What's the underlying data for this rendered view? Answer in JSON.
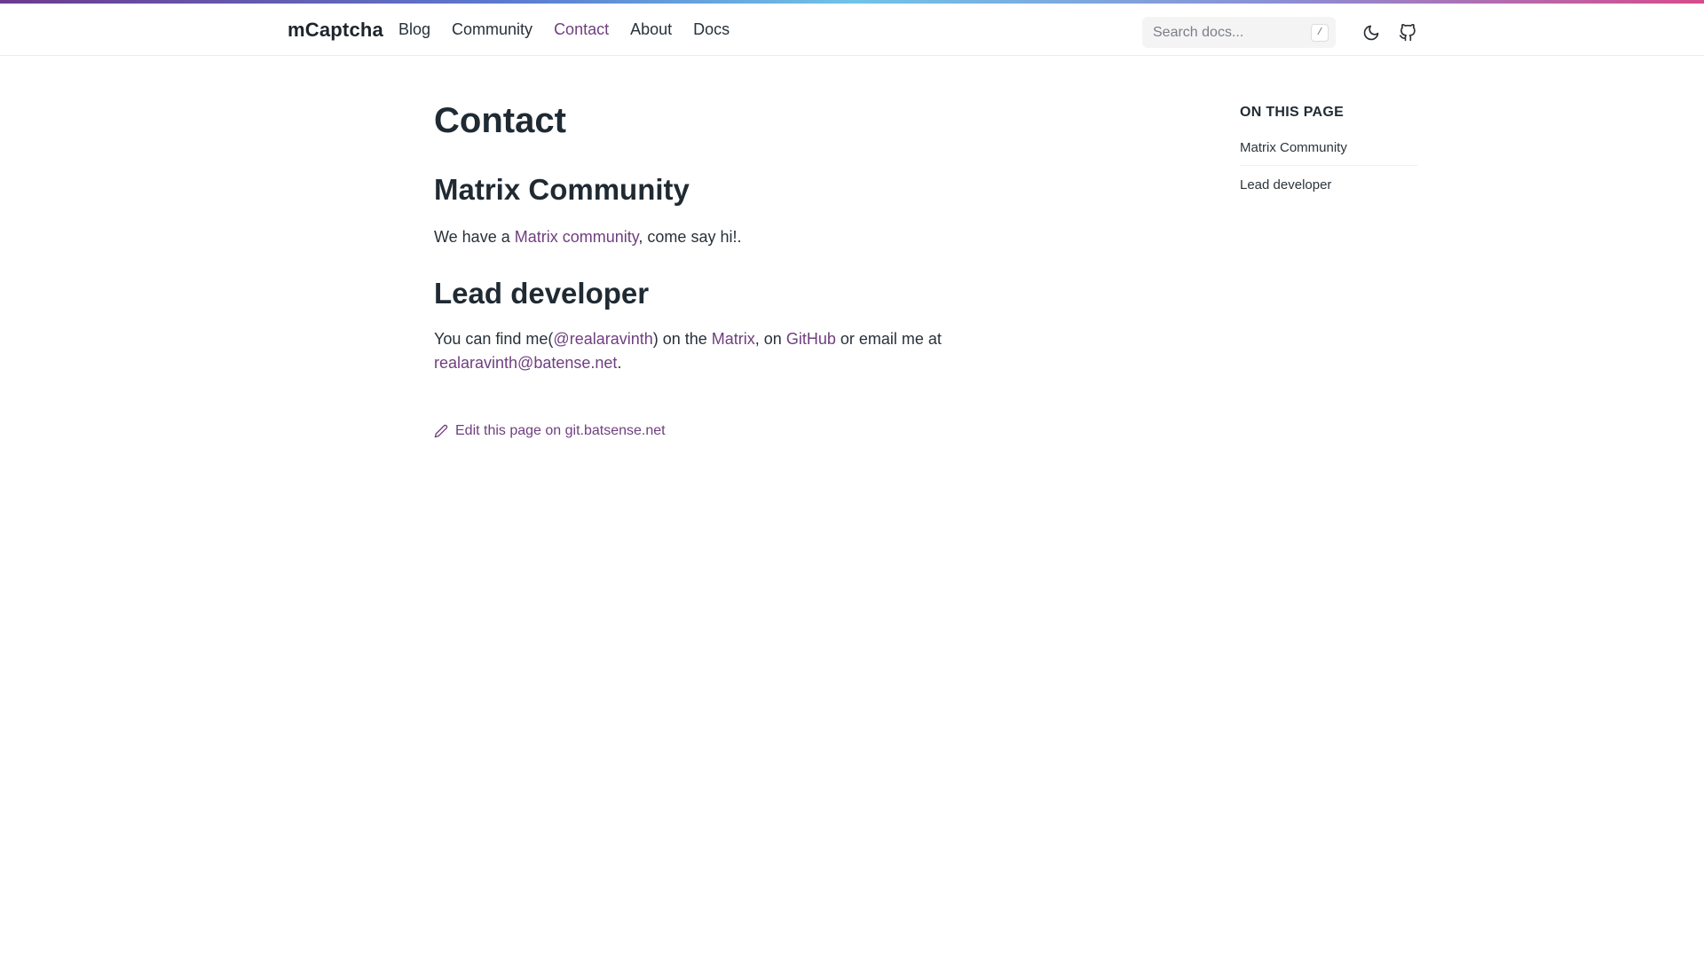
{
  "header": {
    "brand": "mCaptcha",
    "nav": [
      {
        "label": "Blog",
        "active": false
      },
      {
        "label": "Community",
        "active": false
      },
      {
        "label": "Contact",
        "active": true
      },
      {
        "label": "About",
        "active": false
      },
      {
        "label": "Docs",
        "active": false
      }
    ],
    "search": {
      "placeholder": "Search docs...",
      "shortcut": "/"
    },
    "icons": [
      "moon-icon",
      "github-icon"
    ]
  },
  "main": {
    "title": "Contact",
    "sections": [
      {
        "heading": "Matrix Community",
        "text_before": "We have a ",
        "link": "Matrix community",
        "text_after": ", come say hi!."
      },
      {
        "heading": "Lead developer",
        "t1": "You can find me(",
        "handle": "@realaravinth",
        "t2": ") on the ",
        "matrix": "Matrix",
        "t3": ", on ",
        "github": "GitHub",
        "t4": " or email me at",
        "email": "realaravinth@batense.net",
        "t5": "."
      }
    ],
    "edit_label": "Edit this page on git.batsense.net"
  },
  "toc": {
    "title": "ON THIS PAGE",
    "items": [
      "Matrix Community",
      "Lead developer"
    ]
  },
  "colors": {
    "accent": "#6f3f7f",
    "text": "#1f2a33"
  }
}
